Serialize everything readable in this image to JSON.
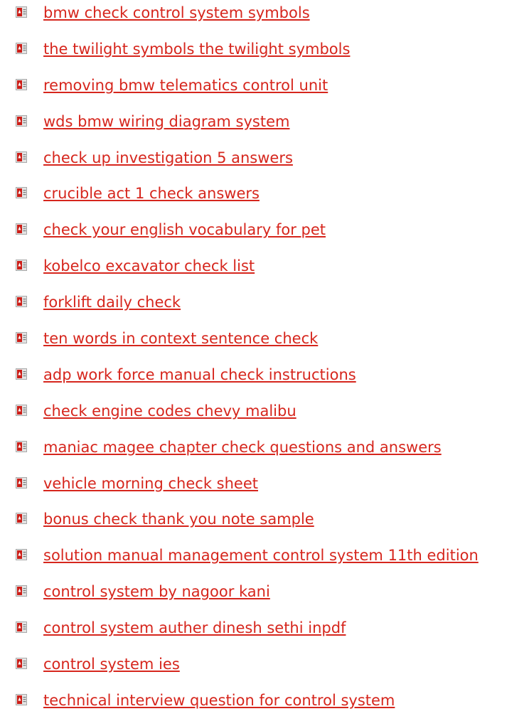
{
  "icon": "pdf-file-icon",
  "link_color": "#d6261d",
  "links": [
    "bmw check control system symbols",
    "the twilight symbols the twilight symbols",
    "removing bmw telematics control unit",
    "wds bmw wiring diagram system",
    "check up investigation 5 answers",
    "crucible act 1 check answers",
    "check your english vocabulary for pet",
    "kobelco excavator check list",
    "forklift daily check",
    "ten words in context sentence check",
    "adp work force manual check instructions",
    "check engine codes chevy malibu",
    "maniac magee chapter check questions and answers",
    "vehicle morning check sheet",
    "bonus check thank you note sample",
    "solution manual management control system 11th edition",
    "control system by nagoor kani",
    "control system auther dinesh sethi inpdf",
    "control system ies",
    "technical interview question for control system"
  ]
}
